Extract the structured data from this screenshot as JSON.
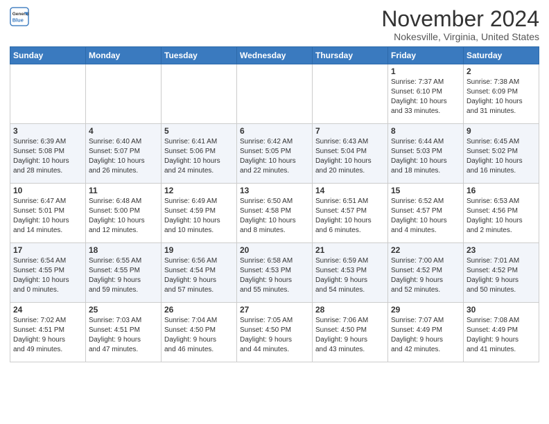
{
  "logo": {
    "line1": "General",
    "line2": "Blue"
  },
  "title": "November 2024",
  "location": "Nokesville, Virginia, United States",
  "weekdays": [
    "Sunday",
    "Monday",
    "Tuesday",
    "Wednesday",
    "Thursday",
    "Friday",
    "Saturday"
  ],
  "weeks": [
    [
      {
        "day": "",
        "info": ""
      },
      {
        "day": "",
        "info": ""
      },
      {
        "day": "",
        "info": ""
      },
      {
        "day": "",
        "info": ""
      },
      {
        "day": "",
        "info": ""
      },
      {
        "day": "1",
        "info": "Sunrise: 7:37 AM\nSunset: 6:10 PM\nDaylight: 10 hours\nand 33 minutes."
      },
      {
        "day": "2",
        "info": "Sunrise: 7:38 AM\nSunset: 6:09 PM\nDaylight: 10 hours\nand 31 minutes."
      }
    ],
    [
      {
        "day": "3",
        "info": "Sunrise: 6:39 AM\nSunset: 5:08 PM\nDaylight: 10 hours\nand 28 minutes."
      },
      {
        "day": "4",
        "info": "Sunrise: 6:40 AM\nSunset: 5:07 PM\nDaylight: 10 hours\nand 26 minutes."
      },
      {
        "day": "5",
        "info": "Sunrise: 6:41 AM\nSunset: 5:06 PM\nDaylight: 10 hours\nand 24 minutes."
      },
      {
        "day": "6",
        "info": "Sunrise: 6:42 AM\nSunset: 5:05 PM\nDaylight: 10 hours\nand 22 minutes."
      },
      {
        "day": "7",
        "info": "Sunrise: 6:43 AM\nSunset: 5:04 PM\nDaylight: 10 hours\nand 20 minutes."
      },
      {
        "day": "8",
        "info": "Sunrise: 6:44 AM\nSunset: 5:03 PM\nDaylight: 10 hours\nand 18 minutes."
      },
      {
        "day": "9",
        "info": "Sunrise: 6:45 AM\nSunset: 5:02 PM\nDaylight: 10 hours\nand 16 minutes."
      }
    ],
    [
      {
        "day": "10",
        "info": "Sunrise: 6:47 AM\nSunset: 5:01 PM\nDaylight: 10 hours\nand 14 minutes."
      },
      {
        "day": "11",
        "info": "Sunrise: 6:48 AM\nSunset: 5:00 PM\nDaylight: 10 hours\nand 12 minutes."
      },
      {
        "day": "12",
        "info": "Sunrise: 6:49 AM\nSunset: 4:59 PM\nDaylight: 10 hours\nand 10 minutes."
      },
      {
        "day": "13",
        "info": "Sunrise: 6:50 AM\nSunset: 4:58 PM\nDaylight: 10 hours\nand 8 minutes."
      },
      {
        "day": "14",
        "info": "Sunrise: 6:51 AM\nSunset: 4:57 PM\nDaylight: 10 hours\nand 6 minutes."
      },
      {
        "day": "15",
        "info": "Sunrise: 6:52 AM\nSunset: 4:57 PM\nDaylight: 10 hours\nand 4 minutes."
      },
      {
        "day": "16",
        "info": "Sunrise: 6:53 AM\nSunset: 4:56 PM\nDaylight: 10 hours\nand 2 minutes."
      }
    ],
    [
      {
        "day": "17",
        "info": "Sunrise: 6:54 AM\nSunset: 4:55 PM\nDaylight: 10 hours\nand 0 minutes."
      },
      {
        "day": "18",
        "info": "Sunrise: 6:55 AM\nSunset: 4:55 PM\nDaylight: 9 hours\nand 59 minutes."
      },
      {
        "day": "19",
        "info": "Sunrise: 6:56 AM\nSunset: 4:54 PM\nDaylight: 9 hours\nand 57 minutes."
      },
      {
        "day": "20",
        "info": "Sunrise: 6:58 AM\nSunset: 4:53 PM\nDaylight: 9 hours\nand 55 minutes."
      },
      {
        "day": "21",
        "info": "Sunrise: 6:59 AM\nSunset: 4:53 PM\nDaylight: 9 hours\nand 54 minutes."
      },
      {
        "day": "22",
        "info": "Sunrise: 7:00 AM\nSunset: 4:52 PM\nDaylight: 9 hours\nand 52 minutes."
      },
      {
        "day": "23",
        "info": "Sunrise: 7:01 AM\nSunset: 4:52 PM\nDaylight: 9 hours\nand 50 minutes."
      }
    ],
    [
      {
        "day": "24",
        "info": "Sunrise: 7:02 AM\nSunset: 4:51 PM\nDaylight: 9 hours\nand 49 minutes."
      },
      {
        "day": "25",
        "info": "Sunrise: 7:03 AM\nSunset: 4:51 PM\nDaylight: 9 hours\nand 47 minutes."
      },
      {
        "day": "26",
        "info": "Sunrise: 7:04 AM\nSunset: 4:50 PM\nDaylight: 9 hours\nand 46 minutes."
      },
      {
        "day": "27",
        "info": "Sunrise: 7:05 AM\nSunset: 4:50 PM\nDaylight: 9 hours\nand 44 minutes."
      },
      {
        "day": "28",
        "info": "Sunrise: 7:06 AM\nSunset: 4:50 PM\nDaylight: 9 hours\nand 43 minutes."
      },
      {
        "day": "29",
        "info": "Sunrise: 7:07 AM\nSunset: 4:49 PM\nDaylight: 9 hours\nand 42 minutes."
      },
      {
        "day": "30",
        "info": "Sunrise: 7:08 AM\nSunset: 4:49 PM\nDaylight: 9 hours\nand 41 minutes."
      }
    ]
  ]
}
